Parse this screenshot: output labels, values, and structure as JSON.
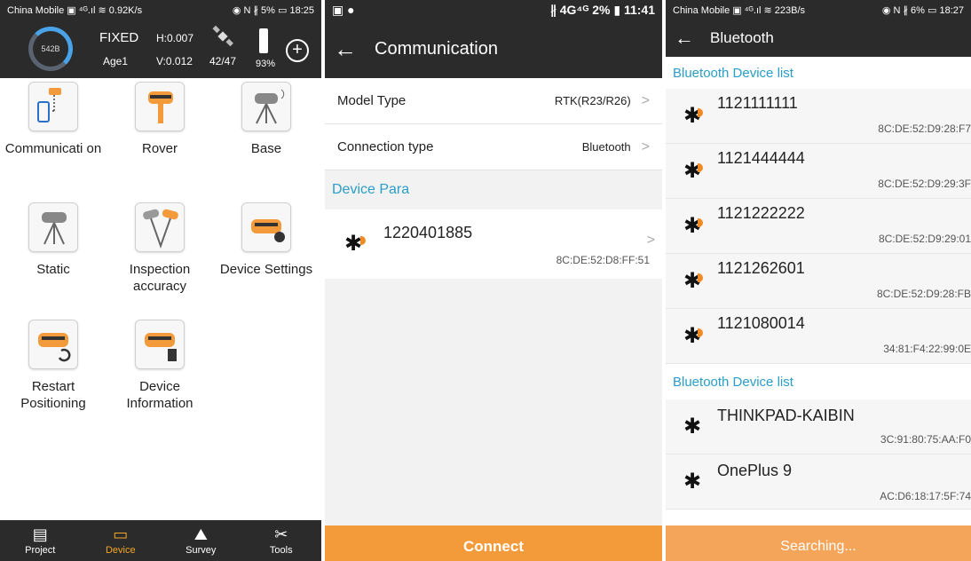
{
  "panel1": {
    "status": {
      "left": "China Mobile ▣ ⁴ᴳ.ıl ≋ 0.92K/s",
      "right": "◉ N ∦ 5% ▭ 18:25"
    },
    "header": {
      "ring_value": "542B",
      "fix_status": "FIXED",
      "age": "Age1",
      "h_precision": "H:0.007",
      "v_precision": "V:0.012",
      "satellites": "42/47",
      "battery": "93%"
    },
    "tiles": [
      {
        "label": "Communicati on",
        "icon": "phone-bluetooth-icon"
      },
      {
        "label": "Rover",
        "icon": "rover-receiver-icon"
      },
      {
        "label": "Base",
        "icon": "base-station-icon"
      },
      {
        "label": "Static",
        "icon": "static-tripod-icon"
      },
      {
        "label": "Inspection accuracy",
        "icon": "inspection-icon"
      },
      {
        "label": "Device Settings",
        "icon": "device-settings-icon"
      },
      {
        "label": "Restart Positioning",
        "icon": "restart-icon"
      },
      {
        "label": "Device Information",
        "icon": "device-info-icon"
      }
    ],
    "nav": [
      {
        "label": "Project",
        "icon": "project-icon"
      },
      {
        "label": "Device",
        "icon": "device-icon"
      },
      {
        "label": "Survey",
        "icon": "survey-icon"
      },
      {
        "label": "Tools",
        "icon": "tools-icon"
      }
    ]
  },
  "panel2": {
    "status": {
      "left": "▣ ●",
      "right": "∦ 4G⁴ᴳ 2% ▮ 11:41"
    },
    "title": "Communication",
    "rows": [
      {
        "label": "Model Type",
        "value": "RTK(R23/R26)"
      },
      {
        "label": "Connection type",
        "value": "Bluetooth"
      }
    ],
    "section": "Device Para",
    "device": {
      "name": "1220401885",
      "mac": "8C:DE:52:D8:FF:51"
    },
    "connect": "Connect"
  },
  "panel3": {
    "status": {
      "left": "China Mobile ▣ ⁴ᴳ.ıl ≋ 223B/s",
      "right": "◉ N ∦ 6% ▭ 18:27"
    },
    "title": "Bluetooth",
    "section1": "Bluetooth Device list",
    "paired": [
      {
        "name": "1121111111",
        "mac": "8C:DE:52:D9:28:F7"
      },
      {
        "name": "1121444444",
        "mac": "8C:DE:52:D9:29:3F"
      },
      {
        "name": "1121222222",
        "mac": "8C:DE:52:D9:29:01"
      },
      {
        "name": "1121262601",
        "mac": "8C:DE:52:D9:28:FB"
      },
      {
        "name": "1121080014",
        "mac": "34:81:F4:22:99:0E"
      }
    ],
    "section2": "Bluetooth Device list",
    "found": [
      {
        "name": "THINKPAD-KAIBIN",
        "mac": "3C:91:80:75:AA:F0"
      },
      {
        "name": "OnePlus 9",
        "mac": "AC:D6:18:17:5F:74"
      }
    ],
    "searching": "Searching..."
  }
}
